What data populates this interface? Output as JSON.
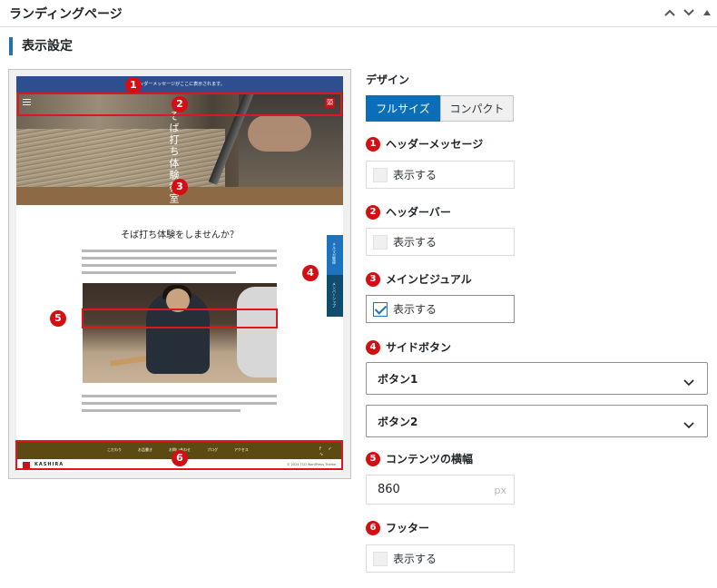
{
  "panel": {
    "title": "ランディングページ"
  },
  "icons": {
    "collapse_up": "chevron-up-icon",
    "collapse_down": "chevron-down-icon",
    "toggle": "triangle-up-icon"
  },
  "section": {
    "title": "表示設定"
  },
  "preview": {
    "header_message": "ヘッダーメッセージがここに表示されます。",
    "hero_title": "そば打ち体験教室",
    "heading": "そば打ち体験をしませんか？",
    "side_buttons": [
      "メルマガ登録",
      "メンバーシップ"
    ],
    "footer_nav": [
      "こだわり",
      "お品書き",
      "お問い合わせ",
      "ブログ",
      "アクセス"
    ],
    "footer_social": "f ✓ ∿",
    "brand": "KASHIRA",
    "copyright": "© 2024 TCD WordPress Theme",
    "logo_glyph": "頭",
    "markers": [
      "1",
      "2",
      "3",
      "4",
      "5",
      "6"
    ]
  },
  "settings": {
    "design": {
      "label": "デザイン",
      "options": [
        "フルサイズ",
        "コンパクト"
      ],
      "selected": "フルサイズ"
    },
    "header_message": {
      "num": "1",
      "label": "ヘッダーメッセージ",
      "checkbox_label": "表示する",
      "checked": false
    },
    "header_bar": {
      "num": "2",
      "label": "ヘッダーバー",
      "checkbox_label": "表示する",
      "checked": false
    },
    "main_visual": {
      "num": "3",
      "label": "メインビジュアル",
      "checkbox_label": "表示する",
      "checked": true
    },
    "side_button": {
      "num": "4",
      "label": "サイドボタン",
      "selects": [
        "ボタン1",
        "ボタン2"
      ]
    },
    "content_width": {
      "num": "5",
      "label": "コンテンツの横幅",
      "value": "860",
      "unit": "px"
    },
    "footer": {
      "num": "6",
      "label": "フッター",
      "checkbox_label": "表示する",
      "checked": false
    }
  }
}
